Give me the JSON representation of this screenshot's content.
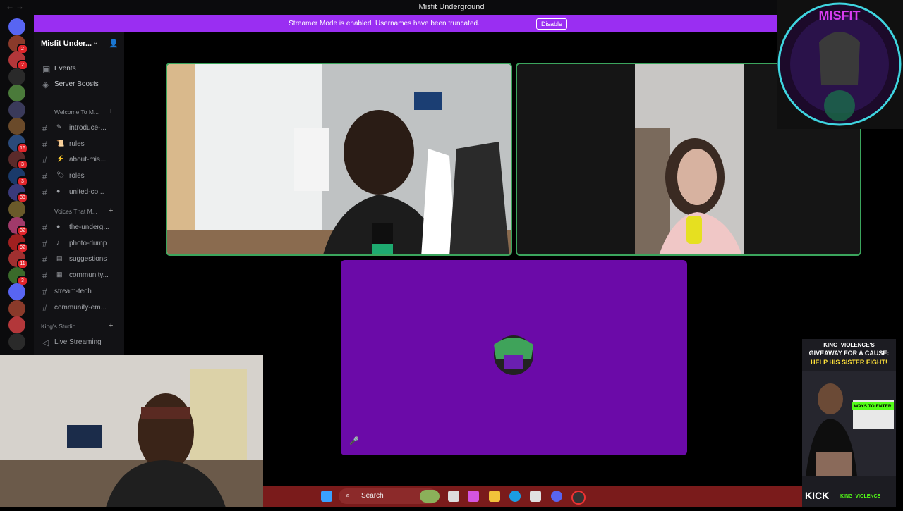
{
  "window": {
    "title": "Misfit Underground",
    "back": "←",
    "forward": "→"
  },
  "banner": {
    "message": "Streamer Mode is enabled. Usernames have been truncated.",
    "button": "Disable"
  },
  "rail": {
    "badges": [
      "2",
      "2",
      "",
      "",
      "",
      "",
      "16",
      "3",
      "3",
      "33",
      "",
      "32",
      "92",
      "11",
      "3"
    ]
  },
  "sidebar": {
    "server_name": "Misfit Under...",
    "top_items": [
      {
        "icon": "calendar-icon",
        "label": "Events"
      },
      {
        "icon": "boost-icon",
        "label": "Server Boosts"
      }
    ],
    "categories": [
      {
        "name": "Welcome To M...",
        "channels": [
          {
            "emoji": "✎",
            "label": "introduce-..."
          },
          {
            "emoji": "📜",
            "label": "rules"
          },
          {
            "emoji": "⚡",
            "label": "about-mis..."
          },
          {
            "emoji": "🏷",
            "label": "roles"
          },
          {
            "emoji": "●",
            "label": "united-co..."
          }
        ]
      },
      {
        "name": "Voices That M...",
        "channels": [
          {
            "emoji": "●",
            "label": "the-underg..."
          },
          {
            "emoji": "♪",
            "label": "photo-dump"
          },
          {
            "emoji": "▤",
            "label": "suggestions"
          },
          {
            "emoji": "▦",
            "label": "community..."
          },
          {
            "emoji": "",
            "label": "stream-tech"
          },
          {
            "emoji": "",
            "label": "community-em..."
          }
        ]
      },
      {
        "name": "King's Studio",
        "channels": [
          {
            "emoji": "🔊",
            "label": "Live Streaming"
          }
        ]
      }
    ]
  },
  "taskbar": {
    "search_label": "Search"
  },
  "poster": {
    "title1": "KING_VIOLENCE'S",
    "title2": "GIVEAWAY FOR A CAUSE:",
    "title3": "HELP HIS SISTER FIGHT!",
    "ways": "WAYS TO ENTER",
    "kick": "KICK",
    "handle": "KING_VIOLENCE"
  },
  "logo": {
    "text": "MISFIT"
  },
  "colors": {
    "banner": "#9a2ef2",
    "speaking": "#3ba55d",
    "activity": "#6b0aa8",
    "taskbar": "#7a1b1b"
  }
}
